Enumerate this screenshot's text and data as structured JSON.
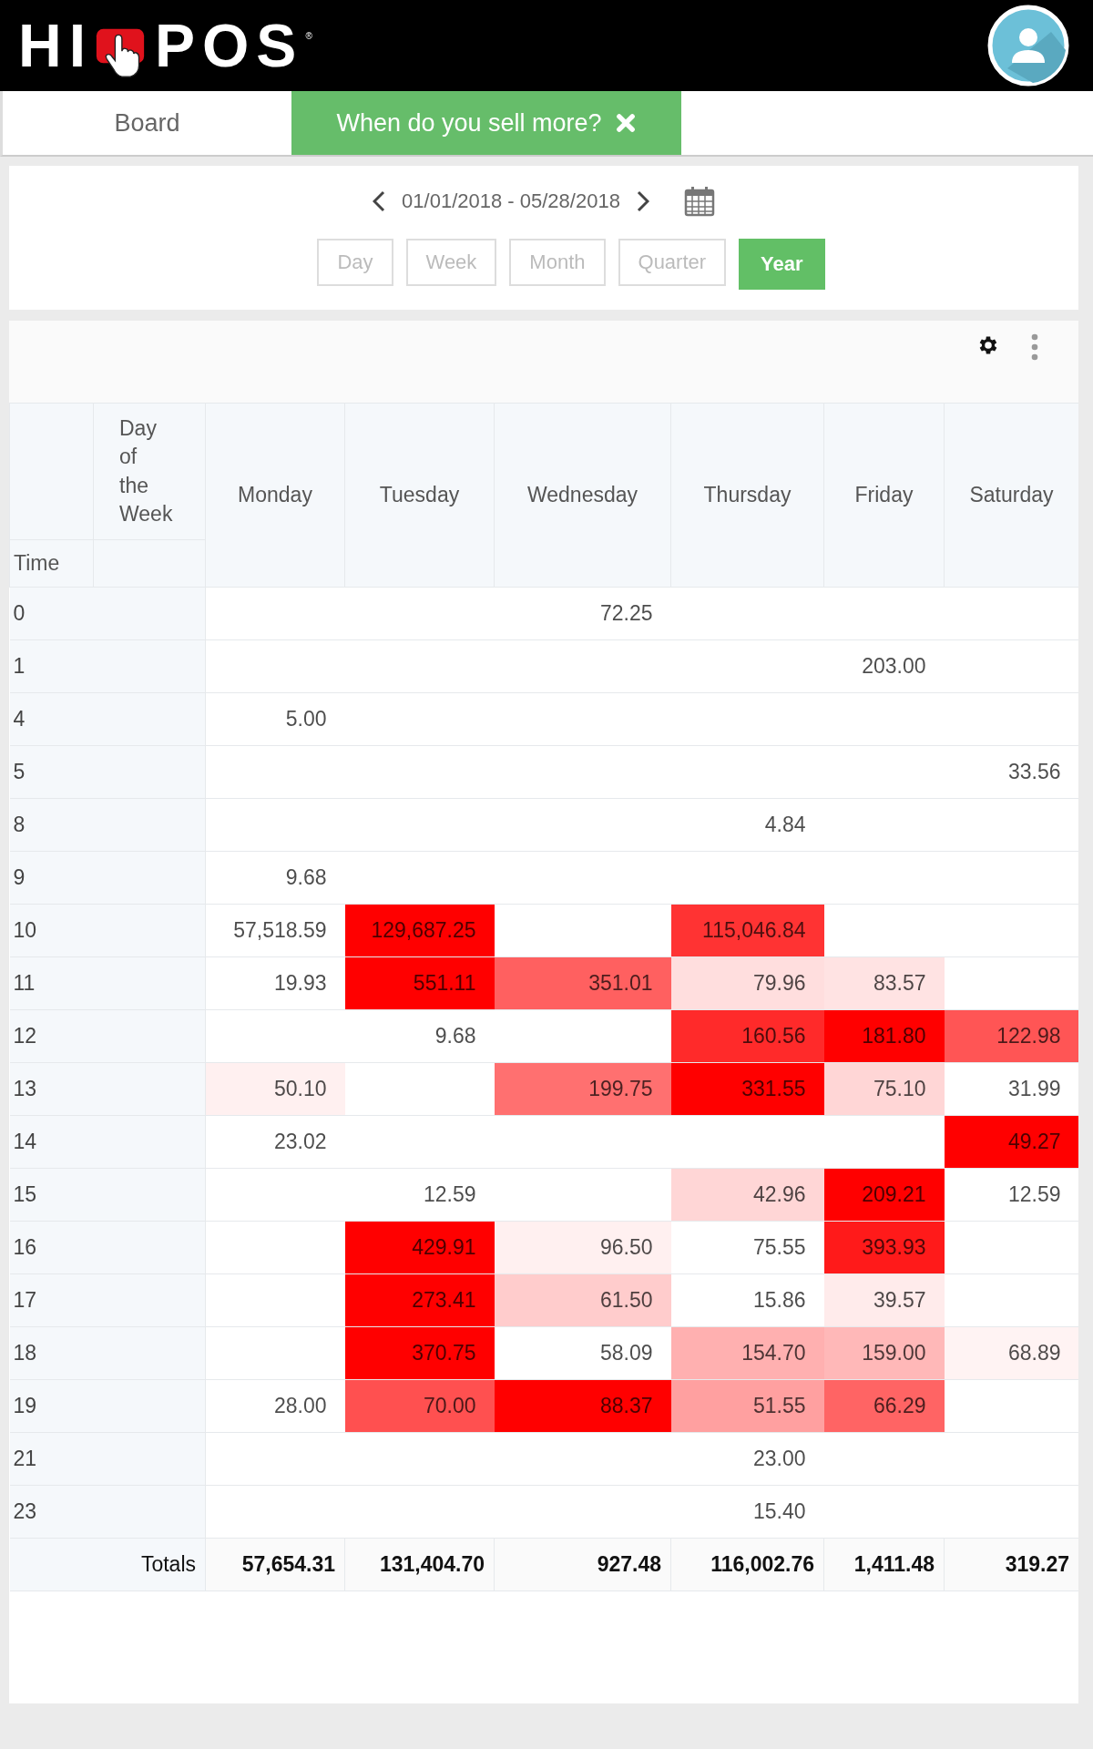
{
  "logo": {
    "left": "HI",
    "right": "POS",
    "mark": "®"
  },
  "tabs": [
    {
      "label": "Board",
      "selected": false,
      "closable": false
    },
    {
      "label": "When do you sell more?",
      "selected": true,
      "closable": true
    }
  ],
  "date_range": "01/01/2018 - 05/28/2018",
  "periods": [
    {
      "label": "Day",
      "selected": false
    },
    {
      "label": "Week",
      "selected": false
    },
    {
      "label": "Month",
      "selected": false
    },
    {
      "label": "Quarter",
      "selected": false
    },
    {
      "label": "Year",
      "selected": true
    }
  ],
  "table": {
    "corner_row_label": "Time",
    "corner_column_label": "Day of the Week",
    "columns": [
      "Monday",
      "Tuesday",
      "Wednesday",
      "Thursday",
      "Friday",
      "Saturday"
    ],
    "rows": [
      {
        "time": "0",
        "cells": [
          null,
          null,
          {
            "value": "72.25"
          },
          null,
          null,
          null
        ]
      },
      {
        "time": "1",
        "cells": [
          null,
          null,
          null,
          null,
          {
            "value": "203.00"
          },
          null
        ]
      },
      {
        "time": "4",
        "cells": [
          {
            "value": "5.00"
          },
          null,
          null,
          null,
          null,
          null
        ]
      },
      {
        "time": "5",
        "cells": [
          null,
          null,
          null,
          null,
          null,
          {
            "value": "33.56"
          }
        ]
      },
      {
        "time": "8",
        "cells": [
          null,
          null,
          null,
          {
            "value": "4.84"
          },
          null,
          null
        ]
      },
      {
        "time": "9",
        "cells": [
          {
            "value": "9.68"
          },
          null,
          null,
          null,
          null,
          null
        ]
      },
      {
        "time": "10",
        "cells": [
          {
            "value": "57,518.59"
          },
          {
            "value": "129,687.25",
            "color": "#ff0000"
          },
          null,
          {
            "value": "115,046.84",
            "color": "#ff3333"
          },
          null,
          null
        ]
      },
      {
        "time": "11",
        "cells": [
          {
            "value": "19.93"
          },
          {
            "value": "551.11",
            "color": "#ff0000"
          },
          {
            "value": "351.01",
            "color": "#ff6060"
          },
          {
            "value": "79.96",
            "color": "#ffdede"
          },
          {
            "value": "83.57",
            "color": "#ffe3e3"
          },
          null
        ]
      },
      {
        "time": "12",
        "cells": [
          null,
          {
            "value": "9.68"
          },
          null,
          {
            "value": "160.56",
            "color": "#ff2a2a"
          },
          {
            "value": "181.80",
            "color": "#ff0000"
          },
          {
            "value": "122.98",
            "color": "#ff5555"
          }
        ]
      },
      {
        "time": "13",
        "cells": [
          {
            "value": "50.10",
            "color": "#fff0f0"
          },
          null,
          {
            "value": "199.75",
            "color": "#ff7070"
          },
          {
            "value": "331.55",
            "color": "#ff0000"
          },
          {
            "value": "75.10",
            "color": "#ffd6d6"
          },
          {
            "value": "31.99"
          }
        ]
      },
      {
        "time": "14",
        "cells": [
          {
            "value": "23.02"
          },
          null,
          null,
          null,
          null,
          {
            "value": "49.27",
            "color": "#ff0000"
          }
        ]
      },
      {
        "time": "15",
        "cells": [
          null,
          {
            "value": "12.59"
          },
          null,
          {
            "value": "42.96",
            "color": "#ffd6d6"
          },
          {
            "value": "209.21",
            "color": "#ff0000"
          },
          {
            "value": "12.59"
          }
        ]
      },
      {
        "time": "16",
        "cells": [
          null,
          {
            "value": "429.91",
            "color": "#ff0000"
          },
          {
            "value": "96.50",
            "color": "#fff0f0"
          },
          {
            "value": "75.55"
          },
          {
            "value": "393.93",
            "color": "#ff1a1a"
          },
          null
        ]
      },
      {
        "time": "17",
        "cells": [
          null,
          {
            "value": "273.41",
            "color": "#ff0000"
          },
          {
            "value": "61.50",
            "color": "#ffcccc"
          },
          {
            "value": "15.86"
          },
          {
            "value": "39.57",
            "color": "#ffebeb"
          },
          null
        ]
      },
      {
        "time": "18",
        "cells": [
          null,
          {
            "value": "370.75",
            "color": "#ff0000"
          },
          {
            "value": "58.09"
          },
          {
            "value": "154.70",
            "color": "#ffb0b0"
          },
          {
            "value": "159.00",
            "color": "#ffb8b8"
          },
          {
            "value": "68.89",
            "color": "#fff3f3"
          }
        ]
      },
      {
        "time": "19",
        "cells": [
          {
            "value": "28.00"
          },
          {
            "value": "70.00",
            "color": "#ff5050"
          },
          {
            "value": "88.37",
            "color": "#ff0000"
          },
          {
            "value": "51.55",
            "color": "#ffa0a0"
          },
          {
            "value": "66.29",
            "color": "#ff6464"
          },
          null
        ]
      },
      {
        "time": "21",
        "cells": [
          null,
          null,
          null,
          {
            "value": "23.00"
          },
          null,
          null
        ]
      },
      {
        "time": "23",
        "cells": [
          null,
          null,
          null,
          {
            "value": "15.40"
          },
          null,
          null
        ]
      }
    ],
    "totals_label": "Totals",
    "totals": [
      "57,654.31",
      "131,404.70",
      "927.48",
      "116,002.76",
      "1,411.48",
      "319.27"
    ]
  }
}
